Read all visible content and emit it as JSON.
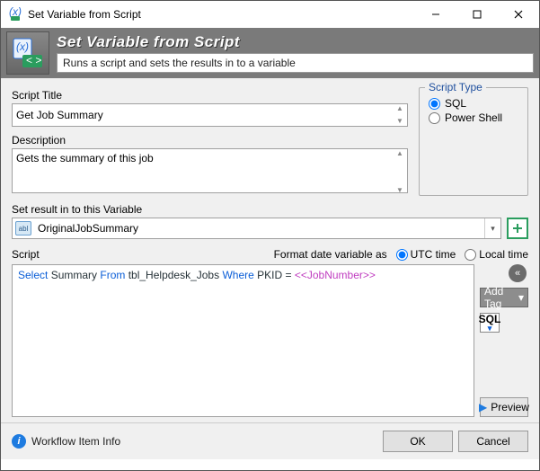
{
  "window": {
    "title": "Set Variable from Script"
  },
  "header": {
    "title": "Set Variable from Script",
    "subtitle": "Runs a script and sets the results in to a variable"
  },
  "fields": {
    "script_title_label": "Script Title",
    "script_title_value": "Get Job Summary",
    "description_label": "Description",
    "description_value": "Gets the summary of this job",
    "variable_label": "Set result in to this Variable",
    "variable_value": "OriginalJobSummary",
    "variable_icon_text": "abl",
    "script_label": "Script"
  },
  "script_type": {
    "legend": "Script Type",
    "options": [
      {
        "label": "SQL",
        "selected": true
      },
      {
        "label": "Power Shell",
        "selected": false
      }
    ]
  },
  "format": {
    "label": "Format date variable as",
    "options": [
      {
        "label": "UTC time",
        "selected": true
      },
      {
        "label": "Local time",
        "selected": false
      }
    ]
  },
  "script": {
    "tokens": [
      {
        "t": "Select",
        "c": "kw"
      },
      {
        "t": " Summary ",
        "c": "ident"
      },
      {
        "t": "From",
        "c": "kw"
      },
      {
        "t": " tbl_Helpdesk_Jobs ",
        "c": "ident"
      },
      {
        "t": "Where",
        "c": "kw"
      },
      {
        "t": " PKID = ",
        "c": "ident"
      },
      {
        "t": "<<JobNumber>>",
        "c": "param"
      }
    ]
  },
  "side": {
    "collapse_glyph": "«",
    "add_tag_label": "Add Tag",
    "add_tag_arrow": "▾",
    "sql_label": "SQL",
    "preview_glyph": "▶",
    "preview_label": "Preview"
  },
  "footer": {
    "info_link": "Workflow Item Info",
    "ok_label": "OK",
    "cancel_label": "Cancel"
  }
}
